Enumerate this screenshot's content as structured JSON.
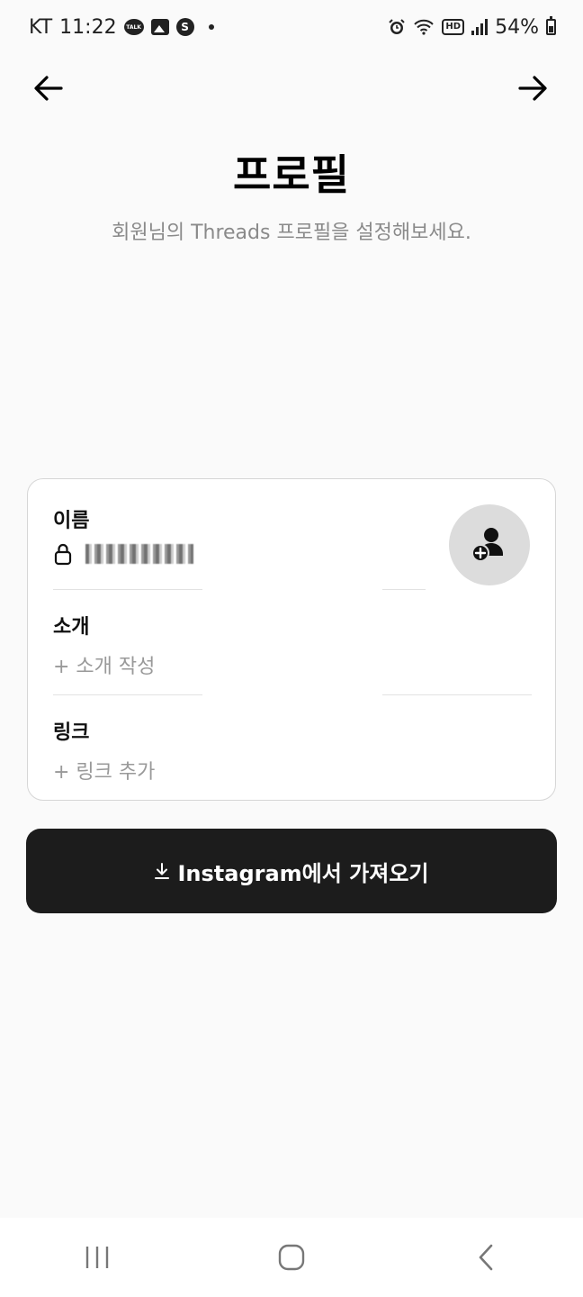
{
  "status_bar": {
    "carrier": "KT",
    "time": "11:22",
    "talk_icon_text": "TALK",
    "s_icon_text": "S",
    "hd_badge": "HD",
    "battery": "54%"
  },
  "header": {
    "title": "프로필",
    "subtitle": "회원님의 Threads 프로필을 설정해보세요."
  },
  "profile_form": {
    "name_label": "이름",
    "bio_label": "소개",
    "bio_placeholder": "+ 소개 작성",
    "link_label": "링크",
    "link_placeholder": "+ 링크 추가"
  },
  "import_button": {
    "label": "Instagram에서 가져오기"
  },
  "colors": {
    "background": "#fafafa",
    "button_bg": "#1c1c1c",
    "placeholder": "#999999"
  }
}
